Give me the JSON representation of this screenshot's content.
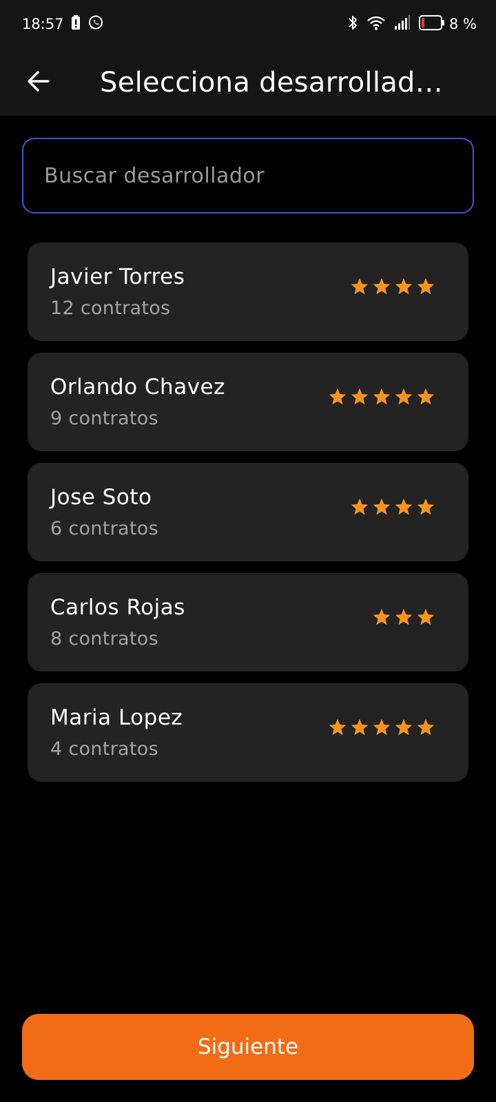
{
  "status_bar": {
    "time": "18:57",
    "battery_percent": "8 %",
    "icons": [
      "battery-alert-icon",
      "whatsapp-icon",
      "bluetooth-icon",
      "wifi-icon",
      "signal-icon",
      "battery-icon"
    ]
  },
  "app_bar": {
    "title": "Selecciona desarrollad…",
    "back_icon": "arrow-back-icon"
  },
  "search": {
    "placeholder": "Buscar desarrollador",
    "value": ""
  },
  "developers": [
    {
      "name": "Javier Torres",
      "contracts": "12 contratos",
      "rating": 4
    },
    {
      "name": "Orlando Chavez",
      "contracts": "9 contratos",
      "rating": 5
    },
    {
      "name": "Jose Soto",
      "contracts": "6 contratos",
      "rating": 4
    },
    {
      "name": "Carlos Rojas",
      "contracts": "8 contratos",
      "rating": 3
    },
    {
      "name": "Maria Lopez",
      "contracts": "4 contratos",
      "rating": 5
    }
  ],
  "next_button": {
    "label": "Siguiente"
  },
  "colors": {
    "accent": "#f26b15",
    "star": "#f7941d",
    "card_bg": "#232323",
    "search_border": "#2f5fd0",
    "battery_low": "#e03a3a"
  }
}
